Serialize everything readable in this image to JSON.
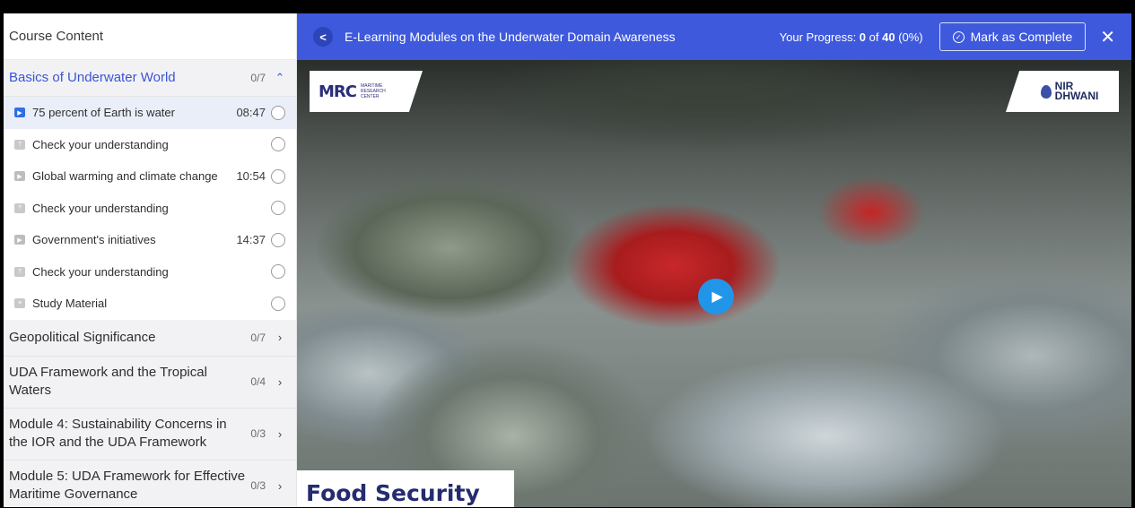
{
  "sidebar": {
    "header": "Course Content",
    "active_section": {
      "title": "Basics of Underwater World",
      "count": "0/7",
      "chevron": "^",
      "lessons": [
        {
          "label": "75 percent of Earth is water",
          "duration": "08:47",
          "icon": "video-icon"
        },
        {
          "label": "Check your understanding",
          "duration": "",
          "icon": "quiz-icon"
        },
        {
          "label": "Global warming and climate change",
          "duration": "10:54",
          "icon": "video-icon"
        },
        {
          "label": "Check your understanding",
          "duration": "",
          "icon": "quiz-icon"
        },
        {
          "label": "Government's initiatives",
          "duration": "14:37",
          "icon": "video-icon"
        },
        {
          "label": "Check your understanding",
          "duration": "",
          "icon": "quiz-icon"
        },
        {
          "label": "Study Material",
          "duration": "",
          "icon": "document-icon"
        }
      ]
    },
    "sections": [
      {
        "line1": "Geopolitical Significance",
        "line2": "",
        "count": "0/7"
      },
      {
        "line1": "UDA Framework and the Tropical",
        "line2": "Waters",
        "count": "0/4"
      },
      {
        "line1": "Module 4: Sustainability Concerns in",
        "line2": "the IOR and the UDA Framework",
        "count": "0/3"
      },
      {
        "line1": "Module 5: UDA Framework for Effective",
        "line2": "Maritime Governance",
        "count": "0/3"
      }
    ]
  },
  "topbar": {
    "back": "<",
    "course_title": "E-Learning Modules on the Underwater Domain Awareness",
    "progress_label": "Your Progress: ",
    "progress_done": "0",
    "progress_of": " of ",
    "progress_total": "40",
    "progress_pct": " (0%)",
    "mark_complete": "Mark as Complete",
    "close": "✕"
  },
  "video": {
    "logo_left_text": "MRC",
    "logo_left_sub_1": "MARITIME",
    "logo_left_sub_2": "RESEARCH",
    "logo_left_sub_3": "CENTER",
    "logo_right_1": "NIR",
    "logo_right_2": "DHWANI",
    "caption": "Food Security"
  },
  "colors": {
    "accent": "#3e59dc",
    "active_text": "#3b55d6",
    "play": "#2196e8",
    "caption_text": "#242b6e"
  }
}
